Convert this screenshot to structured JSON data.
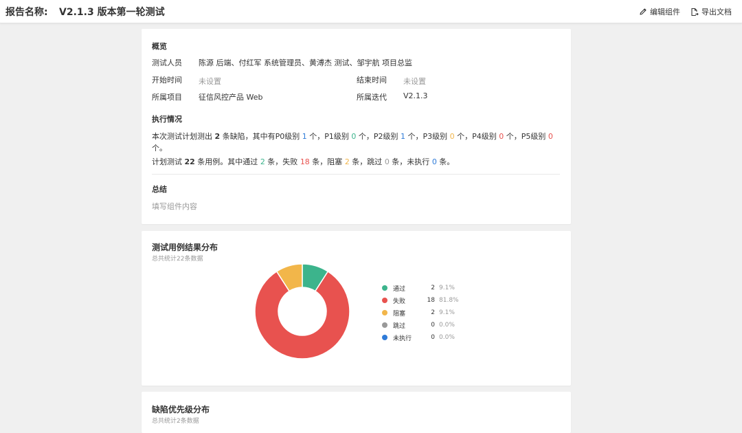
{
  "header": {
    "title_label": "报告名称:",
    "title_value": "V2.1.3 版本第一轮测试",
    "edit_label": "编辑组件",
    "export_label": "导出文档"
  },
  "overview": {
    "title": "概览",
    "testers_label": "测试人员",
    "testers_value": "陈源 后端、付红军 系统管理员、黄溥杰 测试、邹宇航 项目总监",
    "start_label": "开始时间",
    "start_value": "未设置",
    "end_label": "结束时间",
    "end_value": "未设置",
    "project_label": "所属项目",
    "project_value": "征信风控产品 Web",
    "iteration_label": "所属迭代",
    "iteration_value": "V2.1.3"
  },
  "execution": {
    "title": "执行情况",
    "bugs": {
      "t1": "本次测试计划测出 ",
      "total": "2",
      "t2": " 条缺陷，其中有P0级别 ",
      "p0": "1",
      "t3": " 个，P1级别 ",
      "p1": "0",
      "t4": " 个，P2级别 ",
      "p2": "1",
      "t5": " 个，P3级别 ",
      "p3": "0",
      "t6": " 个，P4级别 ",
      "p4": "0",
      "t7": " 个，P5级别 ",
      "p5": "0",
      "t8": "个。"
    },
    "cases": {
      "t1": "计划测试 ",
      "total": "22",
      "t2": " 条用例。其中通过 ",
      "pass": "2",
      "t3": " 条，失败 ",
      "fail": "18",
      "t4": " 条，阻塞 ",
      "blocked": "2",
      "t5": " 条，跳过 ",
      "skipped": "0",
      "t6": " 条，未执行 ",
      "notrun": "0",
      "t7": " 条。"
    }
  },
  "summary": {
    "title": "总结",
    "placeholder": "填写组件内容"
  },
  "case_distribution": {
    "title": "测试用例结果分布",
    "subtitle": "总共统计22条数据"
  },
  "chart_data": {
    "type": "pie",
    "donut": true,
    "total": 22,
    "slices": [
      {
        "name": "通过",
        "value": 2,
        "percent": "9.1%",
        "color": "#3cb48c"
      },
      {
        "name": "失败",
        "value": 18,
        "percent": "81.8%",
        "color": "#e8524f"
      },
      {
        "name": "阻塞",
        "value": 2,
        "percent": "9.1%",
        "color": "#f2b64a"
      },
      {
        "name": "跳过",
        "value": 0,
        "percent": "0.0%",
        "color": "#999999"
      },
      {
        "name": "未执行",
        "value": 0,
        "percent": "0.0%",
        "color": "#2f7bd8"
      }
    ]
  },
  "defect_distribution": {
    "title": "缺陷优先级分布",
    "subtitle": "总共统计2条数据"
  }
}
